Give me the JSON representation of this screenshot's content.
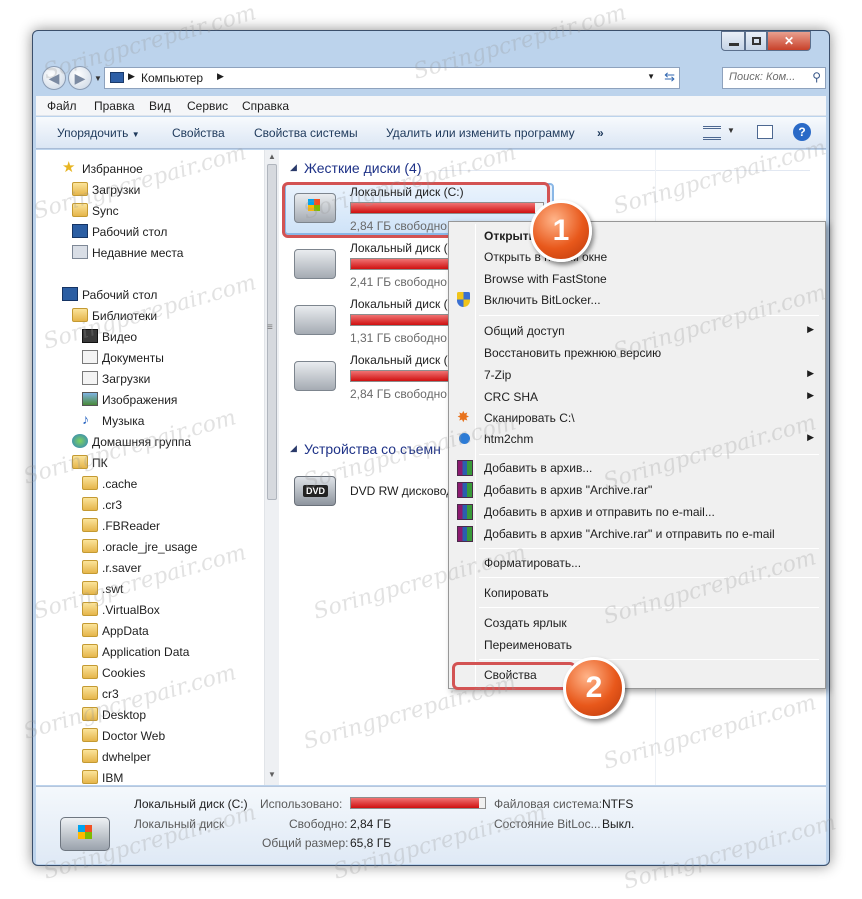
{
  "address": {
    "crumb": "Компьютер",
    "search_placeholder": "Поиск: Ком..."
  },
  "menu": [
    "Файл",
    "Правка",
    "Вид",
    "Сервис",
    "Справка"
  ],
  "toolbar": {
    "organize": "Упорядочить",
    "properties": "Свойства",
    "system_properties": "Свойства системы",
    "uninstall": "Удалить или изменить программу",
    "more": "»"
  },
  "nav": {
    "favorites": "Избранное",
    "downloads": "Загрузки",
    "sync": "Sync",
    "desktop_fav": "Рабочий стол",
    "recent": "Недавние места",
    "desktop": "Рабочий стол",
    "libraries": "Библиотеки",
    "video": "Видео",
    "documents": "Документы",
    "downloads2": "Загрузки",
    "images": "Изображения",
    "music": "Музыка",
    "homegroup": "Домашняя группа",
    "pc": "ПК",
    "folders": [
      ".cache",
      ".cr3",
      ".FBReader",
      ".oracle_jre_usage",
      ".r.saver",
      ".swt",
      ".VirtualBox",
      "AppData",
      "Application Data",
      "Cookies",
      "cr3",
      "Desktop",
      "Doctor Web",
      "dwhelper",
      "IBM"
    ]
  },
  "main": {
    "hdd_section": "Жесткие диски (4)",
    "removable_section": "Устройства со съемн",
    "drives": [
      {
        "name": "Локальный диск (C:)",
        "free": "2,84 ГБ свободно из 65,8 ГБ",
        "used_fraction": 0.957
      },
      {
        "name": "Локальный диск (",
        "free": "2,41 ГБ свободно",
        "used_fraction": 0.96
      },
      {
        "name": "Локальный диск (",
        "free": "1,31 ГБ свободно",
        "used_fraction": 0.97
      },
      {
        "name": "Локальный диск (",
        "free": "2,84 ГБ свободно",
        "used_fraction": 0.96
      }
    ],
    "dvd": "DVD RW дисковод",
    "dvd_badge": "DVD"
  },
  "context_menu": {
    "open": "Открыть",
    "open_new": "Открыть в новом окне",
    "faststone": "Browse with FastStone",
    "bitlocker": "Включить BitLocker...",
    "share": "Общий доступ",
    "restore": "Восстановить прежнюю версию",
    "zip": "7-Zip",
    "crc": "CRC SHA",
    "scan": "Сканировать C:\\",
    "htm2chm": "htm2chm",
    "add_archive": "Добавить в архив...",
    "add_rar": "Добавить в архив \"Archive.rar\"",
    "add_email": "Добавить в архив и отправить по e-mail...",
    "add_rar_email": "Добавить в архив \"Archive.rar\" и отправить по e-mail",
    "format": "Форматировать...",
    "copy": "Копировать",
    "shortcut": "Создать ярлык",
    "rename": "Переименовать",
    "properties": "Свойства"
  },
  "callouts": [
    "1",
    "2"
  ],
  "details": {
    "name": "Локальный диск (C:)",
    "type": "Локальный диск",
    "used_label": "Использовано:",
    "free_label": "Свободно:",
    "free_value": "2,84 ГБ",
    "total_label": "Общий размер:",
    "total_value": "65,8 ГБ",
    "fs_label": "Файловая система:",
    "fs_value": "NTFS",
    "bitlocker_label": "Состояние BitLoc...",
    "bitlocker_value": "Выкл.",
    "used_fraction": 0.957
  },
  "watermark": "Soringpcrepair.com",
  "colors": {
    "accent_ring": "#d35353",
    "callout": "#e8581b",
    "bar_fill": "#cf1010"
  }
}
